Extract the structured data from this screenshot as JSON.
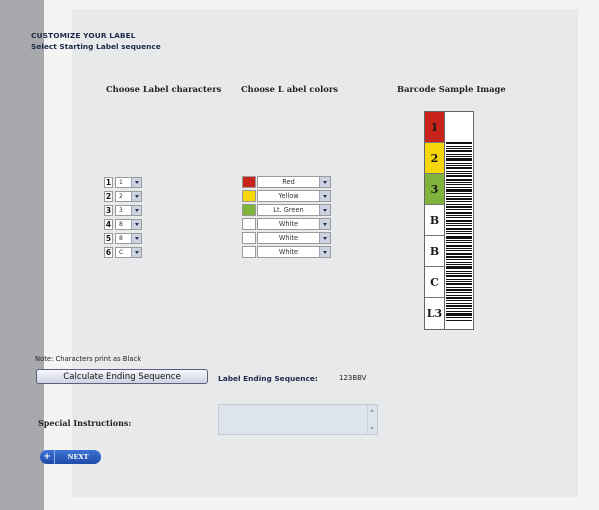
{
  "header": {
    "title": "CUSTOMIZE YOUR LABEL",
    "subtitle": "Select Starting Label sequence"
  },
  "columns": {
    "characters": "Choose Label characters",
    "colors": "Choose L abel colors",
    "barcode": "Barcode Sample Image"
  },
  "characters": [
    {
      "position": "1",
      "value": "1"
    },
    {
      "position": "2",
      "value": "2"
    },
    {
      "position": "3",
      "value": "3"
    },
    {
      "position": "4",
      "value": "8"
    },
    {
      "position": "5",
      "value": "8"
    },
    {
      "position": "6",
      "value": "C"
    }
  ],
  "colors": [
    {
      "label": "Red",
      "hex": "#c8231b"
    },
    {
      "label": "Yellow",
      "hex": "#f4d60a"
    },
    {
      "label": "Lt. Green",
      "hex": "#7fb33c"
    },
    {
      "label": "White",
      "hex": "#ffffff"
    },
    {
      "label": "White",
      "hex": "#ffffff"
    },
    {
      "label": "White",
      "hex": "#ffffff"
    }
  ],
  "barcode": {
    "segments": [
      {
        "char": "1",
        "color": "#c8231b",
        "text_color": "#1a1a1a"
      },
      {
        "char": "2",
        "color": "#f4d60a",
        "text_color": "#1a1a1a"
      },
      {
        "char": "3",
        "color": "#7fb33c",
        "text_color": "#1a1a1a"
      },
      {
        "char": "B",
        "color": "#ffffff",
        "text_color": "#1a1a1a"
      },
      {
        "char": "B",
        "color": "#ffffff",
        "text_color": "#1a1a1a"
      },
      {
        "char": "C",
        "color": "#ffffff",
        "text_color": "#1a1a1a"
      },
      {
        "char": "L3",
        "color": "#ffffff",
        "text_color": "#1a1a1a"
      }
    ]
  },
  "note": "Note: Characters print as Black",
  "calc_button": "Calculate Ending Sequence",
  "ending": {
    "label": "Label Ending Sequence:",
    "value": "123BBV"
  },
  "special": {
    "label": "Special Instructions:",
    "value": ""
  },
  "next_button": {
    "icon": "+",
    "label": "NEXT"
  }
}
